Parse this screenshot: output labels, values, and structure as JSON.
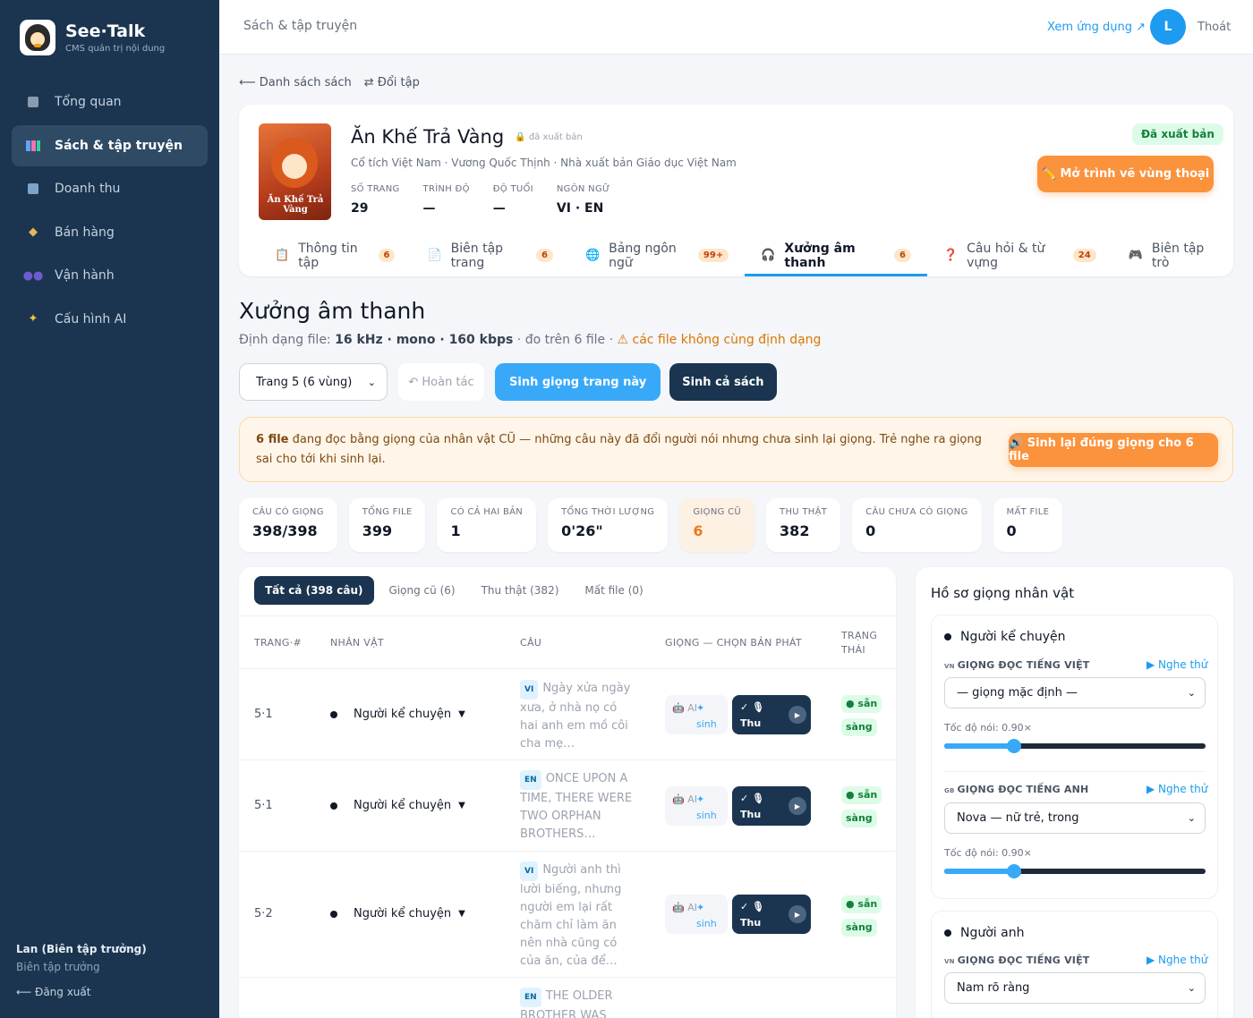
{
  "brand": {
    "name": "See·Talk",
    "subtitle": "CMS quản trị nội dung"
  },
  "nav": [
    {
      "label": "Tổng quan",
      "icon": "grid-icon"
    },
    {
      "label": "Sách & tập truyện",
      "icon": "books-icon",
      "active": true
    },
    {
      "label": "Doanh thu",
      "icon": "chart-icon"
    },
    {
      "label": "Bán hàng",
      "icon": "tag-icon"
    },
    {
      "label": "Vận hành",
      "icon": "users-icon"
    },
    {
      "label": "Cấu hình AI",
      "icon": "sparkle-icon"
    }
  ],
  "user": {
    "name": "Lan (Biên tập trưởng)",
    "role": "Biên tập trưởng",
    "logout": "⟵ Đăng xuất"
  },
  "topbar": {
    "breadcrumb": "Sách & tập truyện",
    "view_app": "Xem ứng dụng ↗",
    "avatar": "L",
    "logout": "Thoát"
  },
  "back": {
    "list": "⟵ Danh sách sách",
    "switch": "⇄ Đổi tập"
  },
  "book": {
    "title": "Ăn Khế Trả Vàng",
    "published_small": "đã xuất bản",
    "cover_text": "Ăn Khế Trả Vàng",
    "meta": "Cổ tích Việt Nam · Vương Quốc Thịnh · Nhà xuất bản Giáo dục Việt Nam",
    "stats": [
      {
        "label": "SỐ TRANG",
        "value": "29"
      },
      {
        "label": "TRÌNH ĐỘ",
        "value": "—"
      },
      {
        "label": "ĐỘ TUỔI",
        "value": "—"
      },
      {
        "label": "NGÔN NGỮ",
        "value": "VI · EN"
      }
    ],
    "status_badge": "Đã xuất bản",
    "open_dialog_btn": "✏️ Mở trình vẽ vùng thoại"
  },
  "tabs": [
    {
      "label": "Thông tin tập",
      "count": "6",
      "icon": "clipboard-icon"
    },
    {
      "label": "Biên tập trang",
      "count": "6",
      "icon": "page-icon"
    },
    {
      "label": "Bảng ngôn ngữ",
      "count": "99+",
      "icon": "globe-icon"
    },
    {
      "label": "Xưởng âm thanh",
      "count": "6",
      "icon": "headphones-icon",
      "active": true
    },
    {
      "label": "Câu hỏi & từ vựng",
      "count": "24",
      "icon": "question-icon"
    },
    {
      "label": "Biên tập trò",
      "count": "",
      "icon": "gamepad-icon"
    }
  ],
  "studio": {
    "title": "Xưởng âm thanh",
    "format_prefix": "Định dạng file: ",
    "format_value": "16 kHz · mono · 160 kbps",
    "format_suffix": " · đo trên 6 file · ",
    "format_warn": "⚠ các file không cùng định dạng",
    "page_select": "Trang 5 (6 vùng)",
    "undo": "↶ Hoàn tác",
    "gen_page": "Sinh giọng trang này",
    "gen_book": "Sinh cả sách"
  },
  "alert": {
    "bold": "6 file",
    "text": " đang đọc bằng giọng của nhân vật CŨ — những câu này đã đổi người nói nhưng chưa sinh lại giọng. Trẻ nghe ra giọng sai cho tới khi sinh lại.",
    "button": "🔊 Sinh lại đúng giọng cho 6 file"
  },
  "metrics": [
    {
      "label": "CÂU CÓ GIỌNG",
      "value": "398/398"
    },
    {
      "label": "TỔNG FILE",
      "value": "399"
    },
    {
      "label": "CÓ CẢ HAI BẢN",
      "value": "1"
    },
    {
      "label": "TỔNG THỜI LƯỢNG",
      "value": "0'26\""
    },
    {
      "label": "GIỌNG CŨ",
      "value": "6",
      "highlight": true
    },
    {
      "label": "THU THẬT",
      "value": "382"
    },
    {
      "label": "CÂU CHƯA CÓ GIỌNG",
      "value": "0"
    },
    {
      "label": "MẤT FILE",
      "value": "0"
    }
  ],
  "filters": [
    "Tất cả (398 câu)",
    "Giọng cũ (6)",
    "Thu thật (382)",
    "Mất file (0)"
  ],
  "table": {
    "headers": {
      "id": "TRANG·#",
      "char": "NHÂN VẬT",
      "sent": "CÂU",
      "voice": "GIỌNG — CHỌN BẢN PHÁT",
      "status_1": "TRẠNG",
      "status_2": "THÁI"
    },
    "rows": [
      {
        "id": "5·1",
        "char": "Người kể chuyện",
        "lang": "VI",
        "sentence": "Ngày xửa ngày xưa, ở nhà nọ có hai anh em mồ côi cha mẹ…",
        "ai_a": "🤖 AI",
        "ai_s": "✦ sinh",
        "rec": "✓ 🎙 Thu thật —",
        "status_1": "● sẵn",
        "status_2": "sàng"
      },
      {
        "id": "5·1",
        "char": "Người kể chuyện",
        "lang": "EN",
        "sentence": "ONCE UPON A TIME, THERE WERE TWO ORPHAN BROTHERS…",
        "ai_a": "🤖 AI",
        "ai_s": "✦ sinh",
        "rec": "✓ 🎙 Thu thật —",
        "status_1": "● sẵn",
        "status_2": "sàng"
      },
      {
        "id": "5·2",
        "char": "Người kể chuyện",
        "lang": "VI",
        "sentence": "Người anh thì lười biếng, nhưng người em lại rất chăm chỉ làm ăn nên nhà cũng có của ăn, của để…",
        "ai_a": "🤖 AI",
        "ai_s": "✦ sinh",
        "rec": "✓ 🎙 Thu thật —",
        "status_1": "● sẵn",
        "status_2": "sàng"
      },
      {
        "id": "",
        "char": "",
        "lang": "EN",
        "sentence": "THE OLDER BROTHER WAS",
        "ai_a": "",
        "ai_s": "",
        "rec": "",
        "status_1": "",
        "status_2": ""
      }
    ]
  },
  "voices": {
    "title": "Hồ sơ giọng nhân vật",
    "profiles": [
      {
        "name": "Người kể chuyện",
        "groups": [
          {
            "flag": "VN",
            "label": "GIỌNG ĐỌC TIẾNG VIỆT",
            "listen": "▶ Nghe thử",
            "select": "— giọng mặc định —",
            "speed": "Tốc độ nói: 0.90×",
            "speed_value": 0.9
          },
          {
            "flag": "GB",
            "label": "GIỌNG ĐỌC TIẾNG ANH",
            "listen": "▶ Nghe thử",
            "select": "Nova — nữ trẻ, trong",
            "speed": "Tốc độ nói: 0.90×",
            "speed_value": 0.9
          }
        ]
      },
      {
        "name": "Người anh",
        "groups": [
          {
            "flag": "VN",
            "label": "GIỌNG ĐỌC TIẾNG VIỆT",
            "listen": "▶ Nghe thử",
            "select": "Nam rõ ràng",
            "speed": "",
            "speed_value": null
          }
        ]
      }
    ]
  },
  "colors": {
    "sidebar": "#1b3550",
    "accent": "#1d9bf0",
    "orange": "#fb923c",
    "success": "#15803d"
  }
}
